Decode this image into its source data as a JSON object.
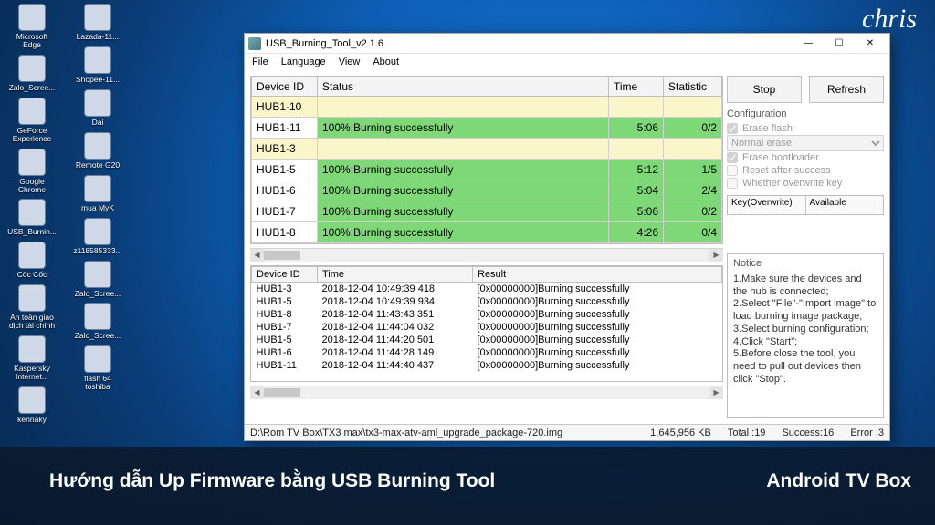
{
  "signature": "chris",
  "overlay": {
    "left": "Hướng dẫn Up Firmware bằng USB Burning Tool",
    "right": "Android TV Box"
  },
  "desktop": {
    "col1": [
      "Microsoft Edge",
      "Zalo_Scree...",
      "GeForce Experience",
      "Google Chrome",
      "USB_Burnin...",
      "Cốc Cốc",
      "An toàn giao dịch tài chính",
      "Kaspersky Internet...",
      "kennaky"
    ],
    "col2": [
      "Lazada-11...",
      "Shopee-11...",
      "Dai",
      "Remote G20",
      "mua MyK",
      "z118585333...",
      "Zalo_Scree...",
      "Zalo_Scree...",
      "flash 64 toshiba"
    ]
  },
  "window": {
    "title": "USB_Burning_Tool_v2.1.6",
    "menu": [
      "File",
      "Language",
      "View",
      "About"
    ],
    "top_grid": {
      "headers": [
        "Device ID",
        "Status",
        "Time",
        "Statistic"
      ],
      "rows": [
        {
          "id": "HUB1-10",
          "status": "",
          "time": "",
          "stat": "",
          "pending": true
        },
        {
          "id": "HUB1-11",
          "status": "100%:Burning successfully",
          "time": "5:06",
          "stat": "0/2",
          "green": true
        },
        {
          "id": "HUB1-3",
          "status": "",
          "time": "",
          "stat": "",
          "pending": true
        },
        {
          "id": "HUB1-5",
          "status": "100%:Burning successfully",
          "time": "5:12",
          "stat": "1/5",
          "green": true
        },
        {
          "id": "HUB1-6",
          "status": "100%:Burning successfully",
          "time": "5:04",
          "stat": "2/4",
          "green": true
        },
        {
          "id": "HUB1-7",
          "status": "100%:Burning successfully",
          "time": "5:06",
          "stat": "0/2",
          "green": true
        },
        {
          "id": "HUB1-8",
          "status": "100%:Burning successfully",
          "time": "4:26",
          "stat": "0/4",
          "green": true
        }
      ]
    },
    "log": {
      "headers": [
        "Device ID",
        "Time",
        "Result"
      ],
      "rows": [
        {
          "id": "HUB1-3",
          "time": "2018-12-04 10:49:39 418",
          "result": "[0x00000000]Burning successfully"
        },
        {
          "id": "HUB1-5",
          "time": "2018-12-04 10:49:39 934",
          "result": "[0x00000000]Burning successfully"
        },
        {
          "id": "HUB1-8",
          "time": "2018-12-04 11:43:43 351",
          "result": "[0x00000000]Burning successfully"
        },
        {
          "id": "HUB1-7",
          "time": "2018-12-04 11:44:04 032",
          "result": "[0x00000000]Burning successfully"
        },
        {
          "id": "HUB1-5",
          "time": "2018-12-04 11:44:20 501",
          "result": "[0x00000000]Burning successfully"
        },
        {
          "id": "HUB1-6",
          "time": "2018-12-04 11:44:28 149",
          "result": "[0x00000000]Burning successfully"
        },
        {
          "id": "HUB1-11",
          "time": "2018-12-04 11:44:40 437",
          "result": "[0x00000000]Burning successfully"
        }
      ]
    },
    "buttons": {
      "stop": "Stop",
      "refresh": "Refresh"
    },
    "config": {
      "title": "Configuration",
      "erase_flash": "Erase flash",
      "erase_mode": "Normal erase",
      "erase_bootloader": "Erase bootloader",
      "reset": "Reset after success",
      "overwrite": "Whether overwrite key"
    },
    "keybox": {
      "left": "Key(Overwrite)",
      "right": "Available"
    },
    "notice": {
      "title": "Notice",
      "lines": [
        "1.Make sure the devices and the hub is connected;",
        "2.Select \"File\"-\"Import image\" to load burning image package;",
        "3.Select burning configuration;",
        "4.Click \"Start\";",
        "5.Before close the tool, you need to pull out devices then click \"Stop\"."
      ]
    },
    "status": {
      "path": "D:\\Rom TV Box\\TX3 max\\tx3-max-atv-aml_upgrade_package-720.img",
      "size": "1,645,956 KB",
      "total": "Total :19",
      "success": "Success:16",
      "error": "Error :3"
    }
  }
}
